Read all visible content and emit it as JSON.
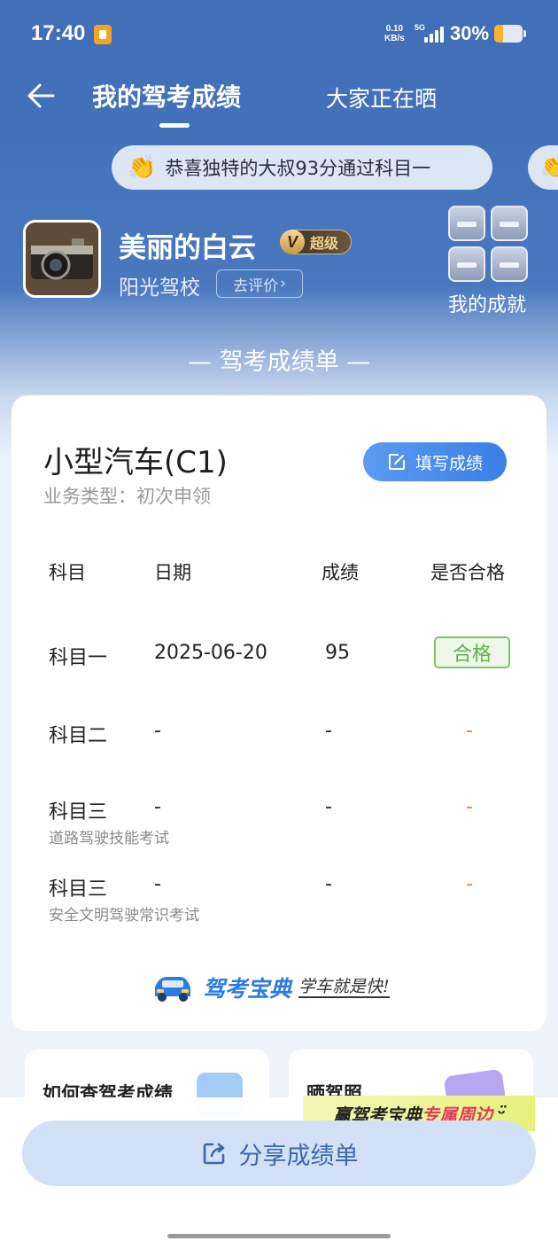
{
  "status_bar": {
    "time": "17:40",
    "net_speed_value": "0.10",
    "net_speed_unit": "KB/s",
    "network": "5G",
    "battery_percent": "30%",
    "battery_level": 0.3
  },
  "nav": {
    "active_tab": "我的驾考成绩",
    "other_tab": "大家正在晒"
  },
  "ticker": {
    "message": "恭喜独特的大叔93分通过科目一",
    "icon": "clapping-hands-icon"
  },
  "profile": {
    "username": "美丽的白云",
    "vip_letter": "V",
    "vip_level": "超级",
    "school": "阳光驾校",
    "rate_button": "去评价",
    "achievements_label": "我的成就"
  },
  "section_title": "— 驾考成绩单 —",
  "card": {
    "car_type": "小型汽车(C1)",
    "business_type": "业务类型：初次申领",
    "fill_button": "填写成绩",
    "headers": [
      "科目",
      "日期",
      "成绩",
      "是否合格"
    ],
    "rows": [
      {
        "subject": "科目一",
        "subtitle": "",
        "date": "2025-06-20",
        "score": "95",
        "pass": "合格"
      },
      {
        "subject": "科目二",
        "subtitle": "",
        "date": "-",
        "score": "-",
        "pass": "-"
      },
      {
        "subject": "科目三",
        "subtitle": "道路驾驶技能考试",
        "date": "-",
        "score": "-",
        "pass": "-"
      },
      {
        "subject": "科目三",
        "subtitle": "安全文明驾驶常识考试",
        "date": "-",
        "score": "-",
        "pass": "-"
      }
    ],
    "brand_name": "驾考宝典",
    "brand_slogan": "学车就是快!"
  },
  "mini_cards": {
    "left_label": "如何查驾考成绩",
    "right_label": "晒驾照"
  },
  "promo": {
    "prefix": "赢驾考宝典",
    "highlight": "专属周边"
  },
  "share_button": "分享成绩单",
  "colors": {
    "header_blue": "#3f6db6",
    "accent_blue": "#3b7fe6",
    "pass_green": "#5cb34a",
    "pending_orange": "#f07a2f"
  }
}
